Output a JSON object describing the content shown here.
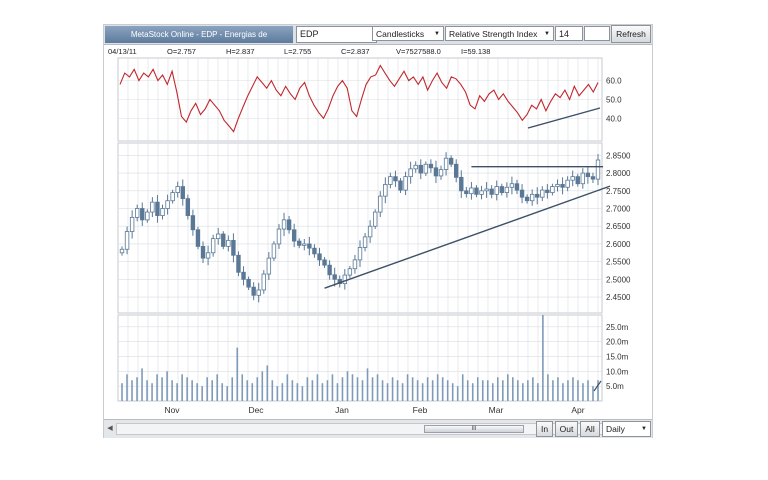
{
  "toolbar": {
    "title": "MetaStock Online - EDP - Energias de",
    "symbol": "EDP",
    "chart_type": "Candlesticks",
    "indicator": "Relative Strength Index",
    "period": "14",
    "refresh_label": "Refresh"
  },
  "info": {
    "date": "04/13/11",
    "open": "O=2.757",
    "high": "H=2.837",
    "low": "L=2.755",
    "close": "C=2.837",
    "volume": "V=7527588.0",
    "indicator_value": "I=59.138"
  },
  "bottom": {
    "scroll_grip": "III",
    "in_label": "In",
    "out_label": "Out",
    "all_label": "All",
    "interval": "Daily"
  },
  "colors": {
    "rsi_line": "#c0282d",
    "candle": "#5a7896",
    "volume": "#7e9ab8",
    "grid": "#d9dde2",
    "trendline": "#3d5066"
  },
  "chart_data": [
    {
      "type": "line",
      "name": "rsi",
      "x_labels": [
        "Nov",
        "Dec",
        "Jan",
        "Feb",
        "Mar",
        "Apr"
      ],
      "y_ticks": [
        "60.0",
        "50.0",
        "40.0"
      ],
      "ylim": [
        28,
        72
      ],
      "values": [
        58,
        64,
        62,
        66,
        60,
        64,
        62,
        66,
        60,
        63,
        58,
        65,
        54,
        41,
        38,
        44,
        48,
        42,
        45,
        50,
        47,
        44,
        39,
        36,
        33,
        40,
        46,
        52,
        57,
        62,
        59,
        56,
        60,
        55,
        52,
        57,
        53,
        50,
        56,
        59,
        52,
        47,
        43,
        40,
        45,
        52,
        57,
        60,
        56,
        44,
        41,
        50,
        58,
        62,
        63,
        68,
        64,
        60,
        57,
        61,
        65,
        60,
        62,
        58,
        62,
        55,
        60,
        64,
        59,
        56,
        62,
        61,
        58,
        54,
        47,
        45,
        52,
        49,
        53,
        55,
        50,
        53,
        49,
        46,
        43,
        39,
        42,
        47,
        45,
        50,
        44,
        49,
        53,
        51,
        55,
        50,
        57,
        52,
        55,
        58,
        54,
        59
      ]
    },
    {
      "type": "candlestick",
      "name": "price",
      "x_labels": [
        "Nov",
        "Dec",
        "Jan",
        "Feb",
        "Mar",
        "Apr"
      ],
      "y_ticks": [
        "2.8500",
        "2.8000",
        "2.7500",
        "2.7000",
        "2.6500",
        "2.6000",
        "2.5500",
        "2.5000",
        "2.4500"
      ],
      "ylim": [
        2.405,
        2.885
      ],
      "closes": [
        2.585,
        2.635,
        2.675,
        2.7,
        2.668,
        2.69,
        2.718,
        2.68,
        2.7,
        2.722,
        2.745,
        2.762,
        2.728,
        2.68,
        2.64,
        2.593,
        2.56,
        2.575,
        2.615,
        2.628,
        2.593,
        2.61,
        2.568,
        2.52,
        2.5,
        2.478,
        2.455,
        2.47,
        2.515,
        2.56,
        2.6,
        2.642,
        2.668,
        2.64,
        2.608,
        2.596,
        2.6,
        2.588,
        2.572,
        2.555,
        2.54,
        2.513,
        2.5,
        2.488,
        2.512,
        2.53,
        2.555,
        2.59,
        2.62,
        2.65,
        2.69,
        2.735,
        2.768,
        2.79,
        2.778,
        2.752,
        2.79,
        2.812,
        2.822,
        2.8,
        2.825,
        2.815,
        2.792,
        2.81,
        2.842,
        2.825,
        2.788,
        2.75,
        2.742,
        2.758,
        2.74,
        2.75,
        2.755,
        2.74,
        2.762,
        2.745,
        2.76,
        2.77,
        2.752,
        2.732,
        2.722,
        2.74,
        2.732,
        2.752,
        2.745,
        2.762,
        2.768,
        2.76,
        2.78,
        2.79,
        2.77,
        2.8,
        2.79,
        2.783,
        2.837
      ],
      "ceiling": 2.818,
      "trendline": [
        [
          40,
          2.475
        ],
        [
          94,
          2.752
        ]
      ]
    },
    {
      "type": "bar",
      "name": "volume",
      "x_labels": [
        "Nov",
        "Dec",
        "Jan",
        "Feb",
        "Mar",
        "Apr"
      ],
      "y_ticks": [
        "25.0m",
        "20.0m",
        "15.0m",
        "10.0m",
        "5.0m"
      ],
      "ylim": [
        0,
        29
      ],
      "values": [
        6,
        9,
        7,
        8,
        11,
        7,
        6,
        9,
        8,
        10,
        7,
        6,
        9,
        8,
        7,
        6,
        5,
        8,
        7,
        9,
        6,
        5,
        8,
        18,
        9,
        7,
        6,
        8,
        10,
        12,
        7,
        5,
        6,
        9,
        7,
        6,
        5,
        8,
        7,
        9,
        6,
        7,
        9,
        6,
        8,
        10,
        9,
        8,
        7,
        11,
        8,
        9,
        7,
        6,
        8,
        7,
        6,
        9,
        8,
        7,
        6,
        8,
        7,
        9,
        8,
        7,
        6,
        5,
        9,
        7,
        6,
        8,
        7,
        7,
        6,
        8,
        7,
        9,
        8,
        7,
        6,
        7,
        8,
        6,
        29,
        9,
        7,
        8,
        6,
        7,
        8,
        7,
        6,
        7,
        5,
        7
      ]
    }
  ]
}
